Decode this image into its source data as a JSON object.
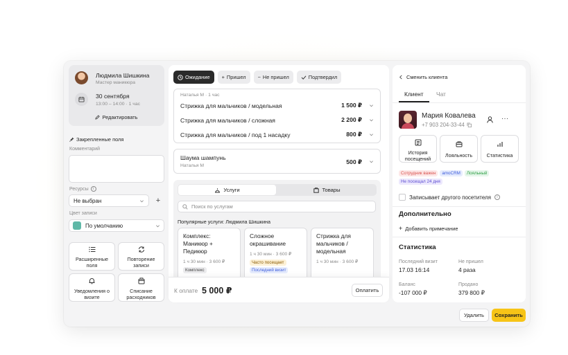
{
  "master": {
    "name": "Людмила Шишкина",
    "role": "Мастер маникюра",
    "date": "30 сентября",
    "time": "13:00 – 14:00 · 1 час",
    "edit_label": "Редактировать"
  },
  "left": {
    "pinned_label": "Закрепленные поля",
    "comment_label": "Комментарий",
    "resources_label": "Ресурсы",
    "resources_value": "Не выбран",
    "color_label": "Цвет записи",
    "color_value": "По умолчанию",
    "color_swatch": "#5fb8a7",
    "tiles": [
      {
        "icon": "list-icon",
        "label": "Расширенные поля"
      },
      {
        "icon": "repeat-icon",
        "label": "Повторение записи"
      },
      {
        "icon": "bell-icon",
        "label": "Уведомления о визите"
      },
      {
        "icon": "box-icon",
        "label": "Списание расходников"
      }
    ]
  },
  "status_chips": [
    {
      "label": "Ожидание",
      "active": true
    },
    {
      "label": "Пришел",
      "active": false
    },
    {
      "label": "Не пришел",
      "active": false
    },
    {
      "label": "Подтвердил",
      "active": false
    }
  ],
  "services_block": {
    "meta": "Наталья М · 1 час",
    "items": [
      {
        "name": "Стрижка для мальчиков / модельная",
        "price": "1 500 ₽"
      },
      {
        "name": "Стрижка для мальчиков / сложная",
        "price": "2 200 ₽"
      },
      {
        "name": "Стрижка для мальчиков / под 1 насадку",
        "price": "800 ₽"
      }
    ]
  },
  "product_block": {
    "name": "Шаума шампунь",
    "meta": "Наталья М",
    "price": "500 ₽"
  },
  "catalog": {
    "tab_services": "Услуги",
    "tab_goods": "Товары",
    "search_placeholder": "Поиск по услугам",
    "popular_title": "Популярные услуги: Людмила Шишкина",
    "cards": [
      {
        "title": "Комплекс: Маникюр + Педикюр",
        "meta": "1 ч 30 мин · 3 600 ₽",
        "tags": [
          "Комплекс"
        ]
      },
      {
        "title": "Сложное окрашивание",
        "meta": "1 ч 30 мин · 3 600 ₽",
        "tags": [
          "Часто посещает",
          "Последний визит"
        ]
      },
      {
        "title": "Стрижка для мальчиков / модельная",
        "meta": "1 ч 30 мин · 3 600 ₽",
        "tags": []
      }
    ]
  },
  "payment": {
    "label": "К оплате",
    "amount": "5 000 ₽",
    "pay_button": "Оплатить"
  },
  "client": {
    "back_label": "Сменить клиента",
    "tab_client": "Клиент",
    "tab_chat": "Чат",
    "name": "Мария Ковалева",
    "phone": "+7 903 204-33-44",
    "actions": [
      {
        "icon": "history-icon",
        "label": "История посещений"
      },
      {
        "icon": "loyalty-icon",
        "label": "Лояльность"
      },
      {
        "icon": "stats-icon",
        "label": "Статистика"
      }
    ],
    "tags": [
      {
        "label": "Сотрудник важен",
        "bg": "#fde7e7",
        "fg": "#d9534f"
      },
      {
        "label": "amoCRM",
        "bg": "#e6ecfd",
        "fg": "#3b5bdb"
      },
      {
        "label": "Лояльный",
        "bg": "#e5f6ea",
        "fg": "#2f9e44"
      },
      {
        "label": "Не посещал 24 дня",
        "bg": "#ece8fd",
        "fg": "#5b4bd1"
      }
    ],
    "other_visitor_label": "Записывает другого посетителя",
    "extra_title": "Дополнительно",
    "add_note_label": "Добавить примечание",
    "stats_title": "Статистика",
    "stats": [
      {
        "label": "Последний визит",
        "value": "17.03 16:14"
      },
      {
        "label": "Не пришел",
        "value": "4 раза"
      },
      {
        "label": "Баланс",
        "value": "-107 000 ₽"
      },
      {
        "label": "Продано",
        "value": "379 800 ₽"
      }
    ]
  },
  "footer": {
    "delete_label": "Удалить",
    "save_label": "Сохранить"
  },
  "colors": {
    "accent": "#f7c417",
    "dark": "#2a2a2a"
  }
}
